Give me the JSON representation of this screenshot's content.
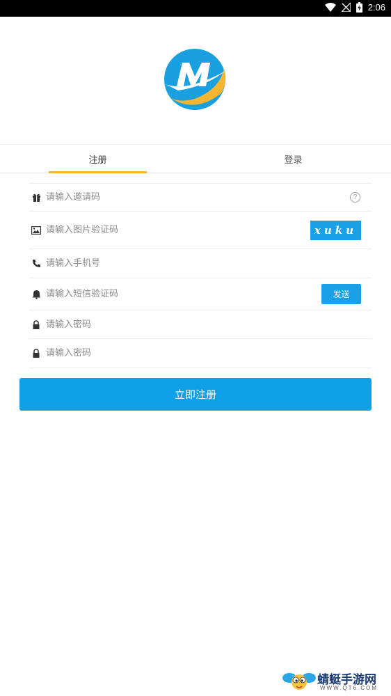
{
  "status_bar": {
    "time": "2:06"
  },
  "tabs": [
    {
      "label": "注册",
      "active": true
    },
    {
      "label": "登录",
      "active": false
    }
  ],
  "form": {
    "invite": {
      "placeholder": "请输入邀请码",
      "icon": "gift-icon",
      "help": "?"
    },
    "image_code": {
      "placeholder": "请输入图片验证码",
      "icon": "image-icon",
      "captcha_text": "xuku"
    },
    "phone": {
      "placeholder": "请输入手机号",
      "icon": "phone-icon"
    },
    "sms_code": {
      "placeholder": "请输入短信验证码",
      "icon": "bell-icon",
      "send_label": "发送"
    },
    "password": {
      "placeholder": "请输入密码",
      "icon": "lock-icon"
    },
    "password_confirm": {
      "placeholder": "请输入密码",
      "icon": "lock-icon"
    }
  },
  "submit_label": "立即注册",
  "watermark": {
    "text": "蜻蜓手游网",
    "url": "WWW.QT6.COM"
  },
  "colors": {
    "accent": "#0fa0e8",
    "tab_indicator": "#f4b433",
    "logo_blue": "#1a9fe0",
    "logo_yellow": "#f5b531"
  }
}
